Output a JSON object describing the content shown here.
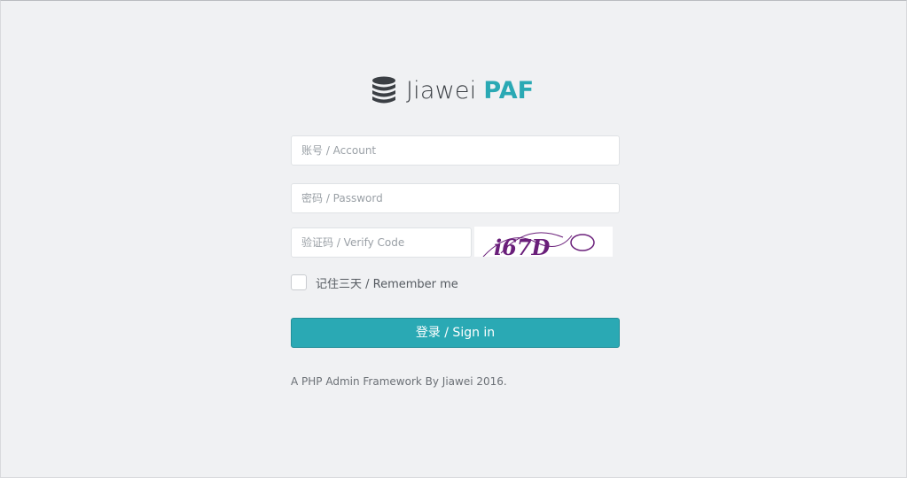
{
  "brand": {
    "name": "Jiawei",
    "accent": "PAF",
    "icon": "database-icon",
    "accent_color": "#2aa9b4"
  },
  "form": {
    "account_placeholder": "账号 / Account",
    "password_placeholder": "密码 / Password",
    "verify_placeholder": "验证码 / Verify Code",
    "remember_label": "记住三天 / Remember me",
    "signin_label": "登录 / Sign in"
  },
  "captcha": {
    "text": "i67D",
    "color": "#6a1f7a"
  },
  "footer": {
    "text": "A PHP Admin Framework By Jiawei 2016."
  },
  "colors": {
    "background": "#f0f1f3",
    "button": "#2aa9b4"
  }
}
